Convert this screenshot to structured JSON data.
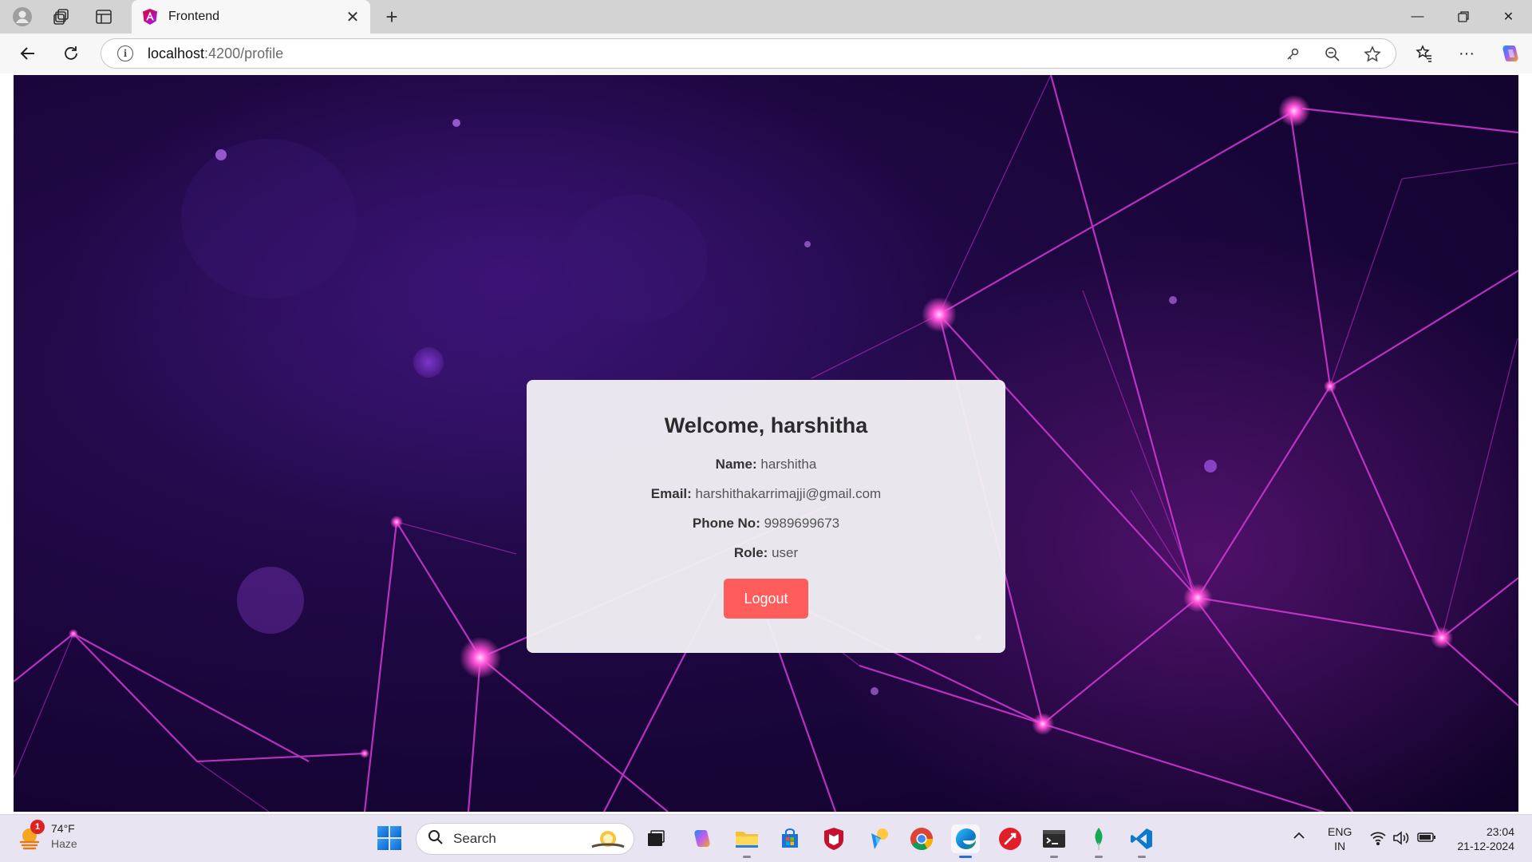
{
  "browser": {
    "tab_title": "Frontend",
    "url_host": "localhost",
    "url_path": ":4200/profile"
  },
  "profile": {
    "heading": "Welcome, harshitha",
    "name_label": "Name:",
    "name_value": "harshitha",
    "email_label": "Email:",
    "email_value": "harshithakarrimajji@gmail.com",
    "phone_label": "Phone No:",
    "phone_value": "9989699673",
    "role_label": "Role:",
    "role_value": "user",
    "logout_label": "Logout",
    "logout_color": "#ff5c5c"
  },
  "taskbar": {
    "weather_badge": "1",
    "weather_temp": "74°F",
    "weather_desc": "Haze",
    "search_label": "Search",
    "lang_line1": "ENG",
    "lang_line2": "IN",
    "time": "23:04",
    "date": "21-12-2024",
    "apps": [
      "task-view",
      "copilot",
      "file-explorer",
      "microsoft-store",
      "mcafee",
      "weather-app",
      "chrome",
      "edge",
      "app-red",
      "terminal",
      "mongodb",
      "vscode"
    ]
  },
  "icons": {
    "back": "arrow-left-icon",
    "refresh": "refresh-icon",
    "info": "info-icon",
    "password_key": "key-icon",
    "zoom": "zoom-out-icon",
    "favorite": "star-icon",
    "favorites": "favorites-icon",
    "more": "ellipsis-icon",
    "copilot": "copilot-icon"
  }
}
